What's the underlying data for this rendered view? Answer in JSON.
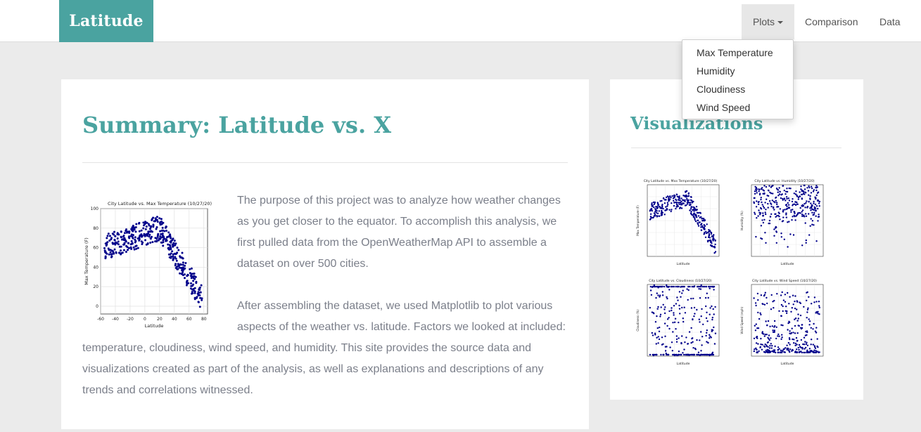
{
  "nav": {
    "brand": "Latitude",
    "plots_label": "Plots",
    "comparison_label": "Comparison",
    "data_label": "Data",
    "dropdown": [
      "Max Temperature",
      "Humidity",
      "Cloudiness",
      "Wind Speed"
    ]
  },
  "summary": {
    "title": "Summary: Latitude vs. X",
    "para1": "The purpose of this project was to analyze how weather changes as you get closer to the equator. To accomplish this analysis, we first pulled data from the OpenWeatherMap API to assemble a dataset on over 500 cities.",
    "para2a": "After assembling the dataset, we used Matplotlib to plot various aspects of the weather vs. latitude. Factors we looked at included:",
    "para2b": "temperature, cloudiness, wind speed, and humidity. This site provides the source data and visualizations created as part of the analysis, as well as explanations and descriptions of any trends and correlations witnessed."
  },
  "visualizations": {
    "title": "Visualizations"
  },
  "summary_plot": {
    "title": "City Latitude vs. Max Temperature (10/27/20)",
    "xlabel": "Latitude",
    "ylabel": "Max Temperature (F)",
    "xticks": [
      "-60",
      "-40",
      "-20",
      "0",
      "20",
      "40",
      "60",
      "80"
    ],
    "yticks": [
      "100",
      "80",
      "60",
      "40",
      "20",
      "0"
    ]
  },
  "thumbnails": [
    {
      "title": "City Latitude vs. Max Temperature (10/27/20)",
      "xlabel": "Latitude",
      "ylabel": "Max Temperature (F)"
    },
    {
      "title": "City Latitude vs. Humidity (10/27/20)",
      "xlabel": "Latitude",
      "ylabel": "Humidity (%)"
    },
    {
      "title": "City Latitude vs. Cloudiness (10/27/20)",
      "xlabel": "Latitude",
      "ylabel": "Cloudiness (%)"
    },
    {
      "title": "City Latitude vs. Wind Speed (10/27/20)",
      "xlabel": "Latitude",
      "ylabel": "Wind Speed (mph)"
    }
  ],
  "colors": {
    "accent": "#4aa3a0",
    "points": "#00008b"
  }
}
